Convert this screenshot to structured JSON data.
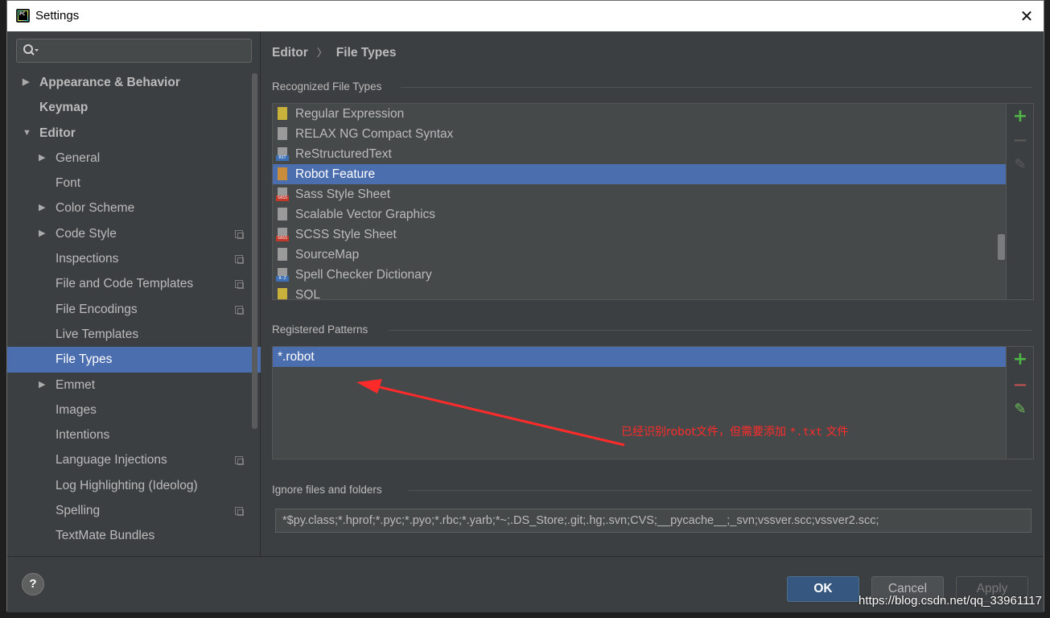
{
  "window": {
    "title": "Settings",
    "app_icon_text": "PC",
    "close_glyph": "✕"
  },
  "sidebar": {
    "search": {
      "value": "",
      "placeholder": ""
    },
    "items": [
      {
        "label": "Appearance & Behavior",
        "level": 0,
        "arrow": "▶",
        "copy": false,
        "selected": false
      },
      {
        "label": "Keymap",
        "level": 0,
        "arrow": "",
        "copy": false,
        "selected": false
      },
      {
        "label": "Editor",
        "level": 0,
        "arrow": "▼",
        "copy": false,
        "selected": false
      },
      {
        "label": "General",
        "level": 1,
        "arrow": "▶",
        "copy": false,
        "selected": false
      },
      {
        "label": "Font",
        "level": 1,
        "arrow": "",
        "copy": false,
        "selected": false
      },
      {
        "label": "Color Scheme",
        "level": 1,
        "arrow": "▶",
        "copy": false,
        "selected": false
      },
      {
        "label": "Code Style",
        "level": 1,
        "arrow": "▶",
        "copy": true,
        "selected": false
      },
      {
        "label": "Inspections",
        "level": 1,
        "arrow": "",
        "copy": true,
        "selected": false
      },
      {
        "label": "File and Code Templates",
        "level": 1,
        "arrow": "",
        "copy": true,
        "selected": false
      },
      {
        "label": "File Encodings",
        "level": 1,
        "arrow": "",
        "copy": true,
        "selected": false
      },
      {
        "label": "Live Templates",
        "level": 1,
        "arrow": "",
        "copy": false,
        "selected": false
      },
      {
        "label": "File Types",
        "level": 1,
        "arrow": "",
        "copy": false,
        "selected": true
      },
      {
        "label": "Emmet",
        "level": 1,
        "arrow": "▶",
        "copy": false,
        "selected": false
      },
      {
        "label": "Images",
        "level": 1,
        "arrow": "",
        "copy": false,
        "selected": false
      },
      {
        "label": "Intentions",
        "level": 1,
        "arrow": "",
        "copy": false,
        "selected": false
      },
      {
        "label": "Language Injections",
        "level": 1,
        "arrow": "",
        "copy": true,
        "selected": false
      },
      {
        "label": "Log Highlighting (Ideolog)",
        "level": 1,
        "arrow": "",
        "copy": false,
        "selected": false
      },
      {
        "label": "Spelling",
        "level": 1,
        "arrow": "",
        "copy": true,
        "selected": false
      },
      {
        "label": "TextMate Bundles",
        "level": 1,
        "arrow": "",
        "copy": false,
        "selected": false
      }
    ]
  },
  "breadcrumb": {
    "parent": "Editor",
    "separator": "〉",
    "current": "File Types"
  },
  "recognized": {
    "title": "Recognized File Types",
    "items": [
      {
        "label": "Regular Expression",
        "icon": "regex-file-icon",
        "color": "#c9b23b",
        "badge": ""
      },
      {
        "label": "RELAX NG Compact Syntax",
        "icon": "rnc-file-icon",
        "color": "#9a9a9a",
        "badge": ""
      },
      {
        "label": "ReStructuredText",
        "icon": "rst-file-icon",
        "color": "#9a9a9a",
        "badge": "RST"
      },
      {
        "label": "Robot Feature",
        "icon": "robot-file-icon",
        "color": "#c98c3b",
        "badge": ""
      },
      {
        "label": "Sass Style Sheet",
        "icon": "sass-file-icon",
        "color": "#9a9a9a",
        "badge": "SASS"
      },
      {
        "label": "Scalable Vector Graphics",
        "icon": "svg-file-icon",
        "color": "#9a9a9a",
        "badge": ""
      },
      {
        "label": "SCSS Style Sheet",
        "icon": "scss-file-icon",
        "color": "#9a9a9a",
        "badge": "SASS"
      },
      {
        "label": "SourceMap",
        "icon": "sourcemap-file-icon",
        "color": "#9a9a9a",
        "badge": ""
      },
      {
        "label": "Spell Checker Dictionary",
        "icon": "dictionary-file-icon",
        "color": "#9a9a9a",
        "badge": "A-Z"
      },
      {
        "label": "SQL",
        "icon": "sql-file-icon",
        "color": "#c9b23b",
        "badge": ""
      }
    ],
    "selected_index": 3
  },
  "patterns": {
    "title": "Registered Patterns",
    "items": [
      "*.robot"
    ],
    "selected_index": 0
  },
  "annotation": {
    "text_prefix": "已经识别robot文件，但需要添加 ",
    "text_code": "*.txt",
    "text_suffix": " 文件",
    "color": "#ff2b2b"
  },
  "ignore": {
    "title": "Ignore files and folders",
    "value": "*$py.class;*.hprof;*.pyc;*.pyo;*.rbc;*.yarb;*~;.DS_Store;.git;.hg;.svn;CVS;__pycache__;_svn;vssver.scc;vssver2.scc;"
  },
  "toolbar": {
    "add_glyph": "+",
    "remove_glyph": "—",
    "edit_glyph": "✎"
  },
  "footer": {
    "help_label": "?",
    "ok_label": "OK",
    "cancel_label": "Cancel",
    "apply_label": "Apply"
  },
  "watermark": "https://blog.csdn.net/qq_33961117",
  "colors": {
    "accent": "#4b6eaf",
    "background": "#3c3f41",
    "add": "#4fb546",
    "remove": "#c75450",
    "edit": "#6ebf5a"
  }
}
